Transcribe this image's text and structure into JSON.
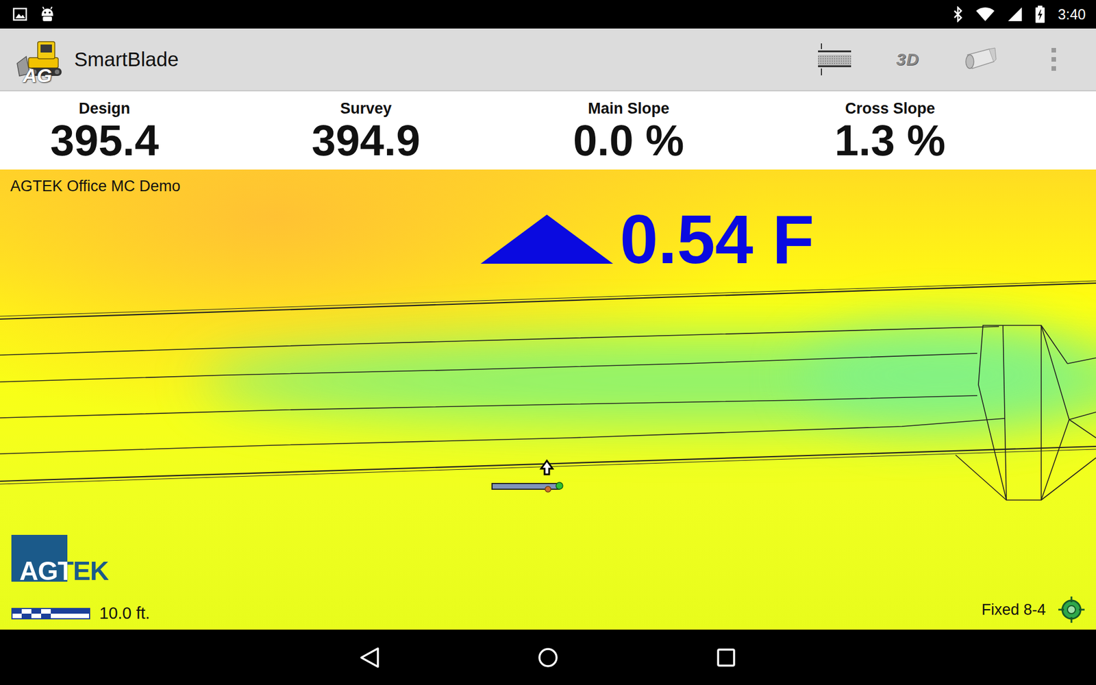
{
  "status_bar": {
    "time": "3:40"
  },
  "app_bar": {
    "icon_text": "AG",
    "title": "SmartBlade",
    "view_3d": "3D"
  },
  "readouts": [
    {
      "label": "Design",
      "value": "395.4"
    },
    {
      "label": "Survey",
      "value": "394.9"
    },
    {
      "label": "Main Slope",
      "value": "0.0 %"
    },
    {
      "label": "Cross Slope",
      "value": "1.3 %"
    }
  ],
  "map": {
    "project": "AGTEK Office MC Demo",
    "indicator": {
      "direction": "up",
      "value": "0.54 F"
    },
    "logo": "AGTEK",
    "scale": "10.0 ft.",
    "gps_status": "Fixed 8-4"
  }
}
